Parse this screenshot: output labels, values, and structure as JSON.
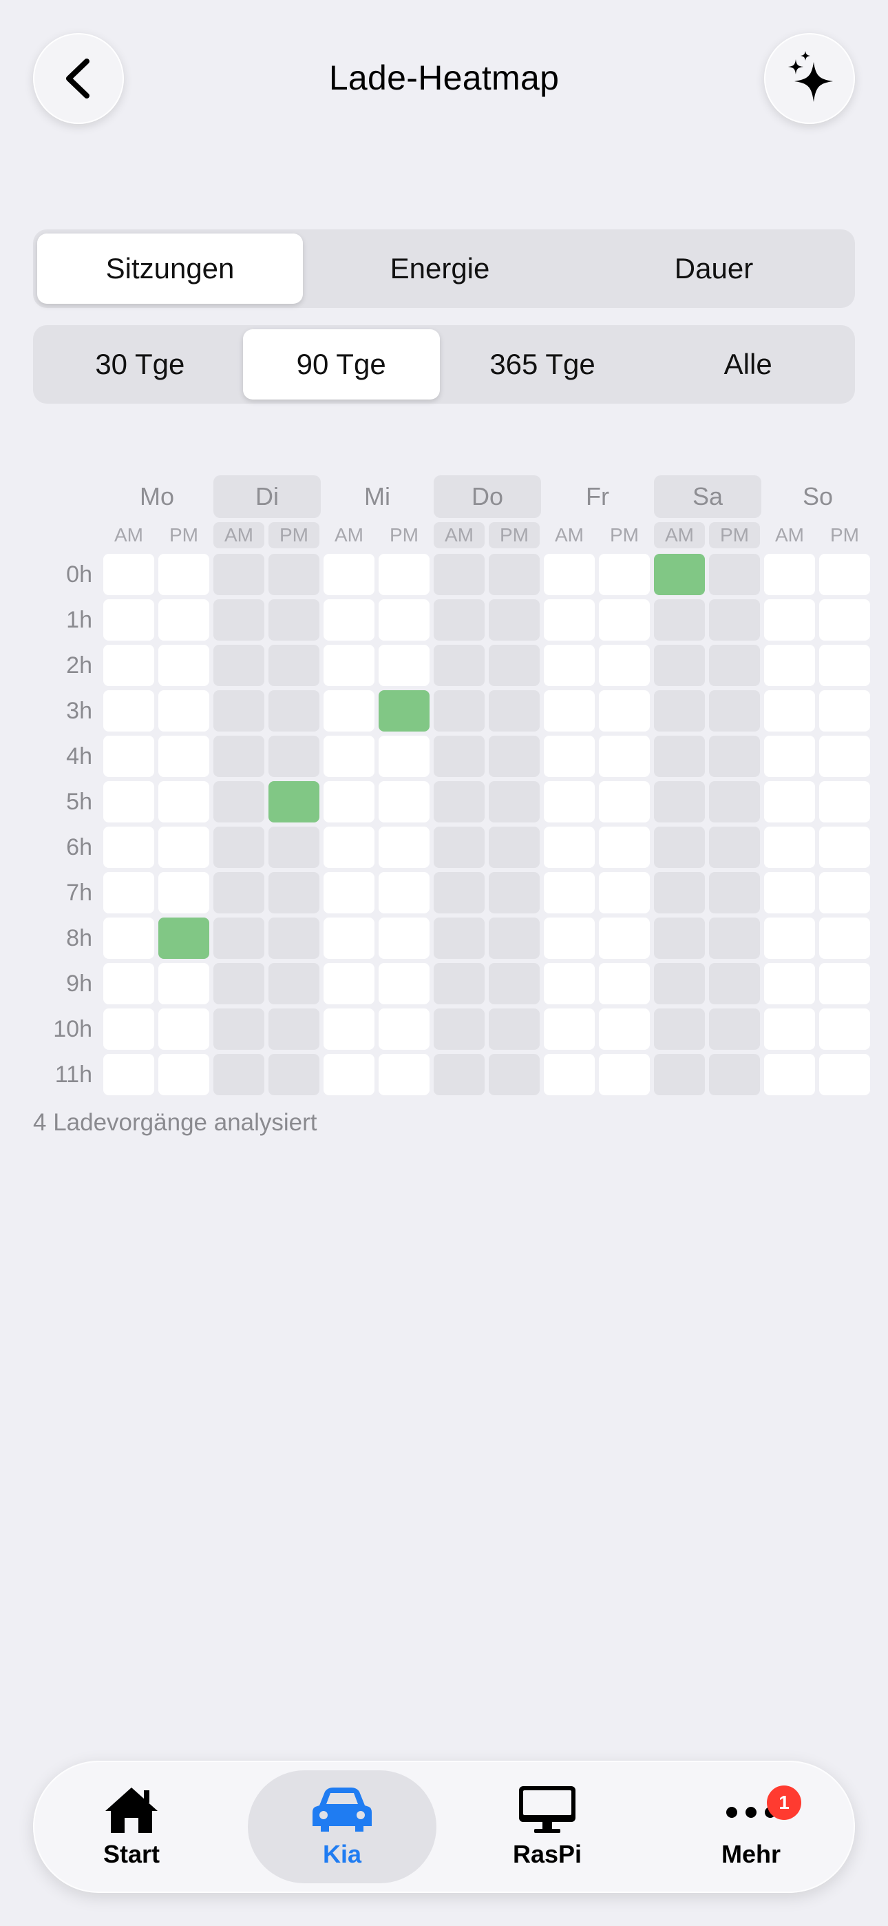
{
  "header": {
    "title": "Lade-Heatmap",
    "back_icon": "chevron-left-icon",
    "action_icon": "sparkles-icon"
  },
  "metric_tabs": [
    {
      "label": "Sitzungen",
      "active": true
    },
    {
      "label": "Energie",
      "active": false
    },
    {
      "label": "Dauer",
      "active": false
    }
  ],
  "range_tabs": [
    {
      "label": "30 Tge",
      "active": false
    },
    {
      "label": "90 Tge",
      "active": true
    },
    {
      "label": "365 Tge",
      "active": false
    },
    {
      "label": "Alle",
      "active": false
    }
  ],
  "heatmap": {
    "days": [
      "Mo",
      "Di",
      "Mi",
      "Do",
      "Fr",
      "Sa",
      "So"
    ],
    "shaded_days": [
      1,
      3,
      5
    ],
    "periods": [
      "AM",
      "PM"
    ],
    "hours": [
      "0h",
      "1h",
      "2h",
      "3h",
      "4h",
      "5h",
      "6h",
      "7h",
      "8h",
      "9h",
      "10h",
      "11h"
    ],
    "sessions": [
      {
        "day": "Mo",
        "period": "PM",
        "hour": "8h",
        "count": 1
      },
      {
        "day": "Di",
        "period": "PM",
        "hour": "5h",
        "count": 1
      },
      {
        "day": "Mi",
        "period": "PM",
        "hour": "3h",
        "count": 1
      },
      {
        "day": "Sa",
        "period": "AM",
        "hour": "0h",
        "count": 1
      }
    ],
    "hit_color": "#81c785",
    "empty_color": "#ffffff",
    "shade_color": "#e1e1e6"
  },
  "summary": "4 Ladevorgänge analysiert",
  "tabbar": {
    "items": [
      {
        "label": "Start",
        "icon": "house-icon",
        "active": false
      },
      {
        "label": "Kia",
        "icon": "car-icon",
        "active": true
      },
      {
        "label": "RasPi",
        "icon": "desktop-icon",
        "active": false
      },
      {
        "label": "Mehr",
        "icon": "ellipsis-icon",
        "active": false,
        "badge": "1"
      }
    ],
    "active_color": "#1f7cf2"
  }
}
